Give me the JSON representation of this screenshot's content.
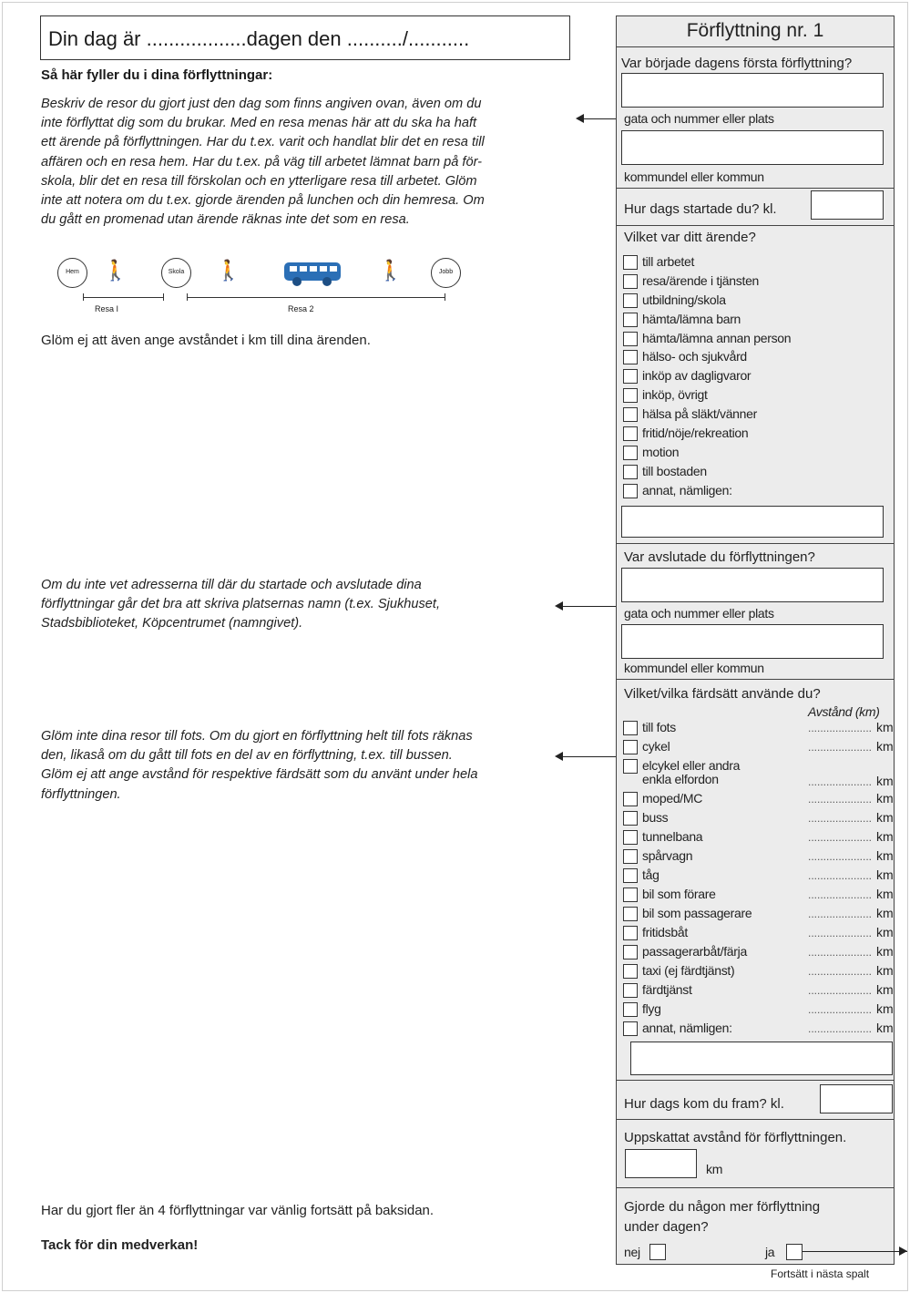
{
  "header": {
    "day_prompt": "Din dag är ..................dagen den ........../...........",
    "instructions_heading": "Så här fyller du i dina förflyttningar:"
  },
  "instructions": {
    "para1": [
      "Beskriv de resor du gjort just den dag som finns angiven ovan, även om du",
      "inte förflyttat dig som du brukar. Med en resa menas här att du ska ha haft",
      "ett ärende på förflyttningen. Har du t.ex. varit och handlat blir det en resa till",
      "affären och en resa hem. Har du t.ex. på väg till arbetet lämnat barn på för-",
      "skola, blir det en resa till förskolan och en ytterligare resa till arbetet. Glöm",
      "inte att notera om du t.ex. gjorde ärenden på lunchen och din hemresa. Om",
      "du gått en promenad utan ärende räknas inte det som en resa."
    ],
    "distance_note": "Glöm ej att även ange avståndet i km till dina ärenden.",
    "para2": [
      "Om du inte vet adresserna till där du startade och avslutade dina",
      "förflyttningar går det bra att skriva platsernas namn (t.ex. Sjukhuset,",
      "Stadsbiblioteket, Köpcentrumet (namngivet)."
    ],
    "para3": [
      "Glöm inte dina resor till fots. Om du gjort en förflyttning helt till fots räknas",
      "den, likaså om du gått till fots en del av en förflyttning, t.ex. till bussen.",
      "Glöm ej att ange avstånd för respektive färdsätt som du använt under hela",
      "förflyttningen."
    ],
    "more_trips": "Har du gjort fler än 4 förflyttningar var vänlig fortsätt på baksidan.",
    "thanks": "Tack för din medverkan!"
  },
  "diagram": {
    "home": "Hem",
    "school": "Skola",
    "work": "Jobb",
    "trip1": "Resa I",
    "trip2": "Resa 2"
  },
  "panel": {
    "title": "Förflyttning nr. 1",
    "start_question": "Var började dagens första förflyttning?",
    "street_label": "gata och nummer eller plats",
    "municipality_label": "kommundel eller kommun",
    "start_time": "Hur dags startade du? kl.",
    "errand_question": "Vilket var ditt ärende?",
    "errands": [
      "till arbetet",
      "resa/ärende i tjänsten",
      "utbildning/skola",
      "hämta/lämna barn",
      "hämta/lämna annan person",
      "hälso- och sjukvård",
      "inköp av dagligvaror",
      "inköp, övrigt",
      "hälsa på släkt/vänner",
      "fritid/nöje/rekreation",
      "motion",
      "till bostaden",
      "annat, nämligen:"
    ],
    "end_question": "Var avslutade du förflyttningen?",
    "mode_question": "Vilket/vilka färdsätt använde du?",
    "distance_header": "Avstånd (km)",
    "modes_ebike": [
      "elcykel eller andra",
      "enkla elfordon"
    ],
    "modes": [
      "till fots",
      "cykel",
      "moped/MC",
      "buss",
      "tunnelbana",
      "spårvagn",
      "tåg",
      "bil som förare",
      "bil som passagerare",
      "fritidsbåt",
      "passagerarbåt/färja",
      "taxi (ej färdtjänst)",
      "färdtjänst",
      "flyg",
      "annat, nämligen:"
    ],
    "dots": ".....................",
    "km_unit": "km",
    "arrival_time": "Hur dags kom du fram? kl.",
    "estimated_distance": "Uppskattat avstånd för förflyttningen.",
    "more_question_1": "Gjorde du någon mer förflyttning",
    "more_question_2": "under dagen?",
    "no": "nej",
    "yes": "ja",
    "continue_note": "Fortsätt i nästa spalt"
  }
}
